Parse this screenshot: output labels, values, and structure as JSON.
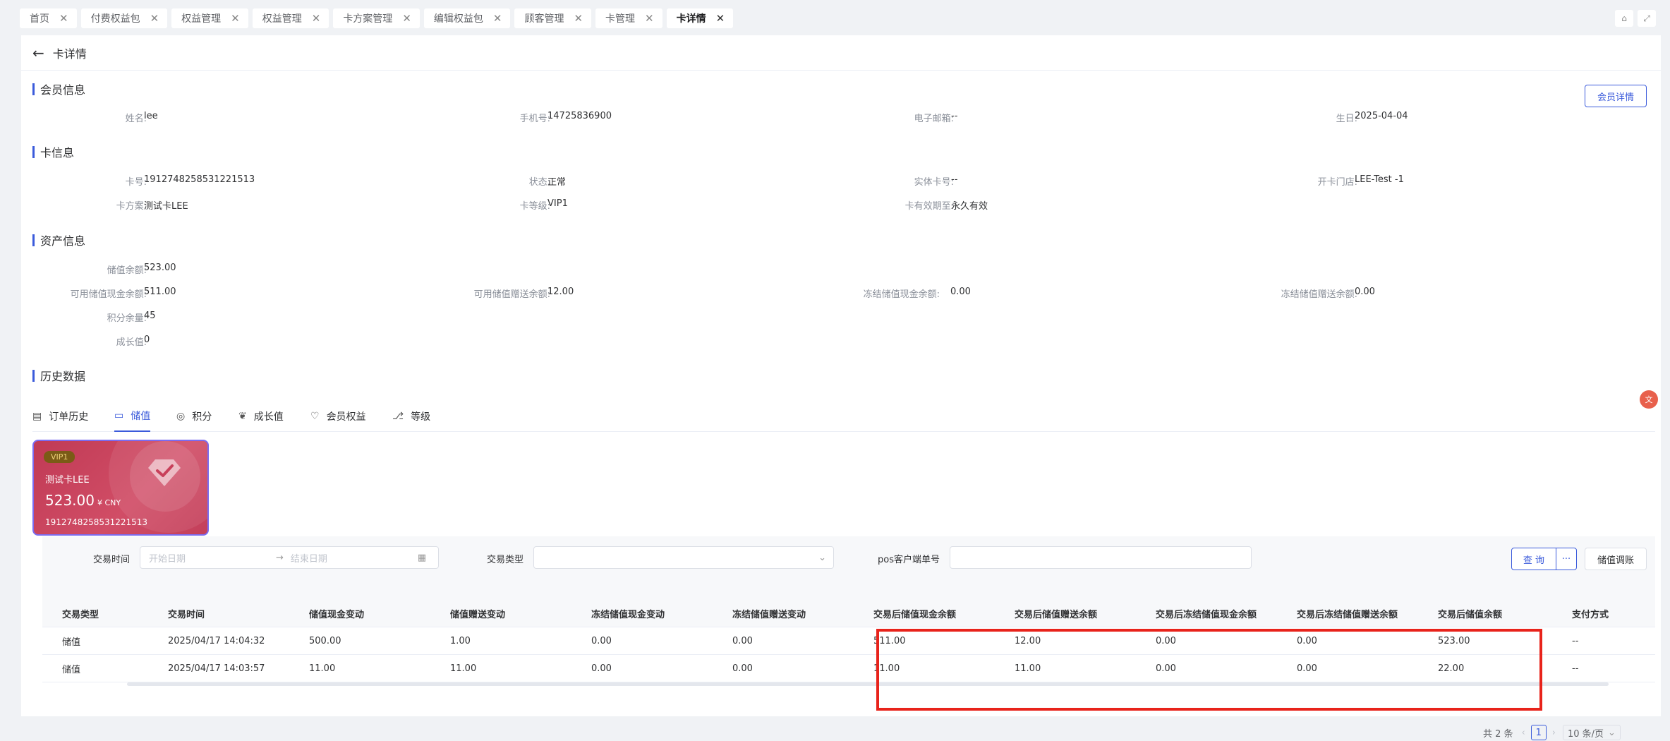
{
  "tabs": [
    {
      "label": "首页",
      "active": false
    },
    {
      "label": "付费权益包",
      "active": false
    },
    {
      "label": "权益管理",
      "active": false
    },
    {
      "label": "权益管理",
      "active": false
    },
    {
      "label": "卡方案管理",
      "active": false
    },
    {
      "label": "编辑权益包",
      "active": false
    },
    {
      "label": "顾客管理",
      "active": false
    },
    {
      "label": "卡管理",
      "active": false
    },
    {
      "label": "卡详情",
      "active": true
    }
  ],
  "page": {
    "title": "卡详情",
    "back_icon": "arrow-left-icon"
  },
  "member": {
    "section": "会员信息",
    "detail_button": "会员详情",
    "name_label": "姓名:",
    "name": "lee",
    "phone_label": "手机号:",
    "phone": "14725836900",
    "email_label": "电子邮箱:",
    "email": "--",
    "birthday_label": "生日:",
    "birthday": "2025-04-04"
  },
  "card_info": {
    "section": "卡信息",
    "no_label": "卡号:",
    "no": "1912748258531221513",
    "status_label": "状态:",
    "status": "正常",
    "physical_label": "实体卡号:",
    "physical": "--",
    "store_label": "开卡门店:",
    "store": "LEE-Test -1",
    "plan_label": "卡方案:",
    "plan": "测试卡LEE",
    "level_label": "卡等级:",
    "level": "VIP1",
    "valid_label": "卡有效期至:",
    "valid": "永久有效"
  },
  "assets": {
    "section": "资产信息",
    "balance_label": "储值余额:",
    "balance": "523.00",
    "cash_label": "可用储值现金余额:",
    "cash": "511.00",
    "gift_label": "可用储值赠送余额:",
    "gift": "12.00",
    "frozen_cash_label": "冻结储值现金余额:",
    "frozen_cash": "0.00",
    "frozen_gift_label": "冻结储值赠送余额:",
    "frozen_gift": "0.00",
    "points_label": "积分余量:",
    "points": "45",
    "growth_label": "成长值:",
    "growth": "0"
  },
  "history": {
    "section": "历史数据",
    "tabs": [
      {
        "label": "订单历史",
        "icon": "document-icon",
        "active": false
      },
      {
        "label": "储值",
        "icon": "wallet-icon",
        "active": true
      },
      {
        "label": "积分",
        "icon": "points-icon",
        "active": false
      },
      {
        "label": "成长值",
        "icon": "leaf-icon",
        "active": false
      },
      {
        "label": "会员权益",
        "icon": "heart-icon",
        "active": false
      },
      {
        "label": "等级",
        "icon": "level-icon",
        "active": false
      }
    ]
  },
  "member_card": {
    "badge": "VIP1",
    "name": "测试卡LEE",
    "amount": "523.00",
    "currency": "¥ CNY",
    "number": "1912748258531221513"
  },
  "filter": {
    "time_label": "交易时间",
    "start_placeholder": "开始日期",
    "end_placeholder": "结束日期",
    "type_label": "交易类型",
    "pos_label": "pos客户端单号",
    "query_button": "查 询",
    "more_button": "···",
    "adjust_button": "储值调账"
  },
  "table": {
    "headers": [
      "交易类型",
      "交易时间",
      "储值现金变动",
      "储值赠送变动",
      "冻结储值现金变动",
      "冻结储值赠送变动",
      "交易后储值现金余额",
      "交易后储值赠送余额",
      "交易后冻结储值现金余额",
      "交易后冻结储值赠送余额",
      "交易后储值余额",
      "支付方式"
    ],
    "rows": [
      [
        "储值",
        "2025/04/17 14:04:32",
        "500.00",
        "1.00",
        "0.00",
        "0.00",
        "511.00",
        "12.00",
        "0.00",
        "0.00",
        "523.00",
        "--"
      ],
      [
        "储值",
        "2025/04/17 14:03:57",
        "11.00",
        "11.00",
        "0.00",
        "0.00",
        "11.00",
        "11.00",
        "0.00",
        "0.00",
        "22.00",
        "--"
      ]
    ]
  },
  "pagination": {
    "total": "共 2 条",
    "current": "1",
    "page_size": "10 条/页"
  },
  "colors": {
    "accent": "#3b5bdb",
    "highlight_box": "#e8231b",
    "card": "#c8405a"
  }
}
